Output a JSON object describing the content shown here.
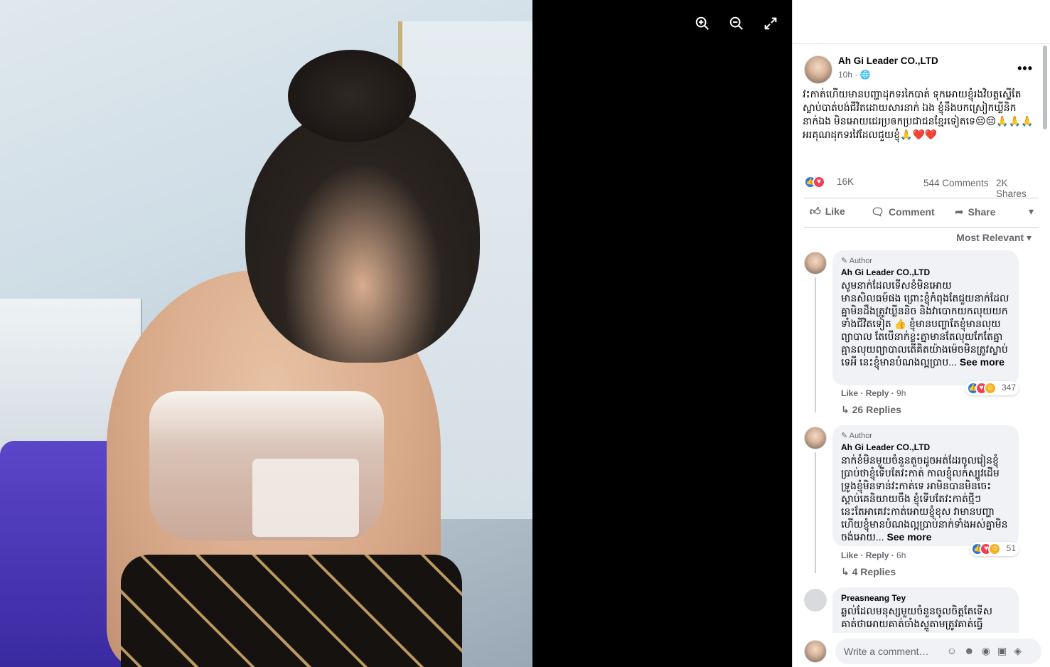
{
  "viewer": {
    "zoom_in_icon": "zoom-in-icon",
    "zoom_out_icon": "zoom-out-icon",
    "fullscreen_icon": "fullscreen-icon"
  },
  "post": {
    "author": "Ah Gi Leader CO.,LTD",
    "time": "10h · 🌐",
    "text": "វះកាត់ហើយមានបញ្ហាដុកទរកៃបាត់ ទុកអោយខ្ញុំរងវិបត្តស្ទើតែស្លាប់បាត់បង់ជីវិតដោយសារនាក់ ឯង ខ្ញុំនឹងបកស្រៀកឃ្លីនិកនាក់ឯង មិនអោយជេរប្រឲកប្រជាជនខ្មែរទៀតទេ😔😔🙏🙏🙏អរគុណដុកទរវៃដែលជួយខ្ញុំ🙏❤️❤️",
    "reactions_count": "16K",
    "comments_count": "544 Comments",
    "shares_count": "2K Shares",
    "actions": {
      "like": "Like",
      "comment": "Comment",
      "share": "Share"
    },
    "sort_label": "Most Relevant"
  },
  "comments": [
    {
      "badge": "Author",
      "name": "Ah Gi Leader CO.,LTD",
      "text": "សូមនាក់ដែលទើសខំមិនអោយមានសិលធម៍ផង ព្រោះខ្ញុំកំពុងតែជួយនាក់ដែលគ្នាមិនដឹងត្រូវឃ្លីននិច និងវាបោកយកលុយយកទាំងជីវិតទៀត 👍 ខ្ញុំមានបញ្ហាតែខ្ញុំមានលុយព្យាបាល តែបើនាក់ខ្លះគ្នាមានតែលុយកែតែគ្នាគ្មានលុយព្យាបាលតើគិតយ៉ាងម៉េចមិនត្រូវស្លាប់ទេអី នេះខ្ញុំមានបំណងល្អប្រាប...",
      "see_more": "See more",
      "like": "Like",
      "reply": "Reply",
      "time": "9h",
      "reaction_count": "347",
      "replies": "26 Replies"
    },
    {
      "badge": "Author",
      "name": "Ah Gi Leader CO.,LTD",
      "text": "នាក់ខំមិនមួយចំនួនតួចដូចអត់ដែរចូលរៀនខ្ញុំប្រាប់ថាខ្ញុំទើបតែវះកាត់ កាលខ្ញុំលក់ស្បូវដើមទ្រូងខ្ញុំមិនទាន់វះកាត់ទេ អាមិនបានមិនចេះស្តាប់គេនិយាយចឹង ខ្ញុំទើបតែវះកាត់ថ្មីៗនេះតែអាគេវះកាត់អោយខ្ញុំខុស វាមានបញ្ហា ហើយខ្ញុំមានបំណងល្អប្រាប់នាក់ទាំងអស់គ្នាមិនចង់អោយ...",
      "see_more": "See more",
      "like": "Like",
      "reply": "Reply",
      "time": "6h",
      "reaction_count": "51",
      "replies": "4 Replies"
    },
    {
      "name": "Preasneang Tey",
      "text": "ឆ្ងល់ដែលមនុស្សមួយចំនួនចូលចិត្តតែទើសគាត់ថាអោយគាត់ចាំងស្ទូតាមត្រូវគាត់ធ្វើ"
    }
  ],
  "composer": {
    "placeholder": "Write a comment…"
  }
}
